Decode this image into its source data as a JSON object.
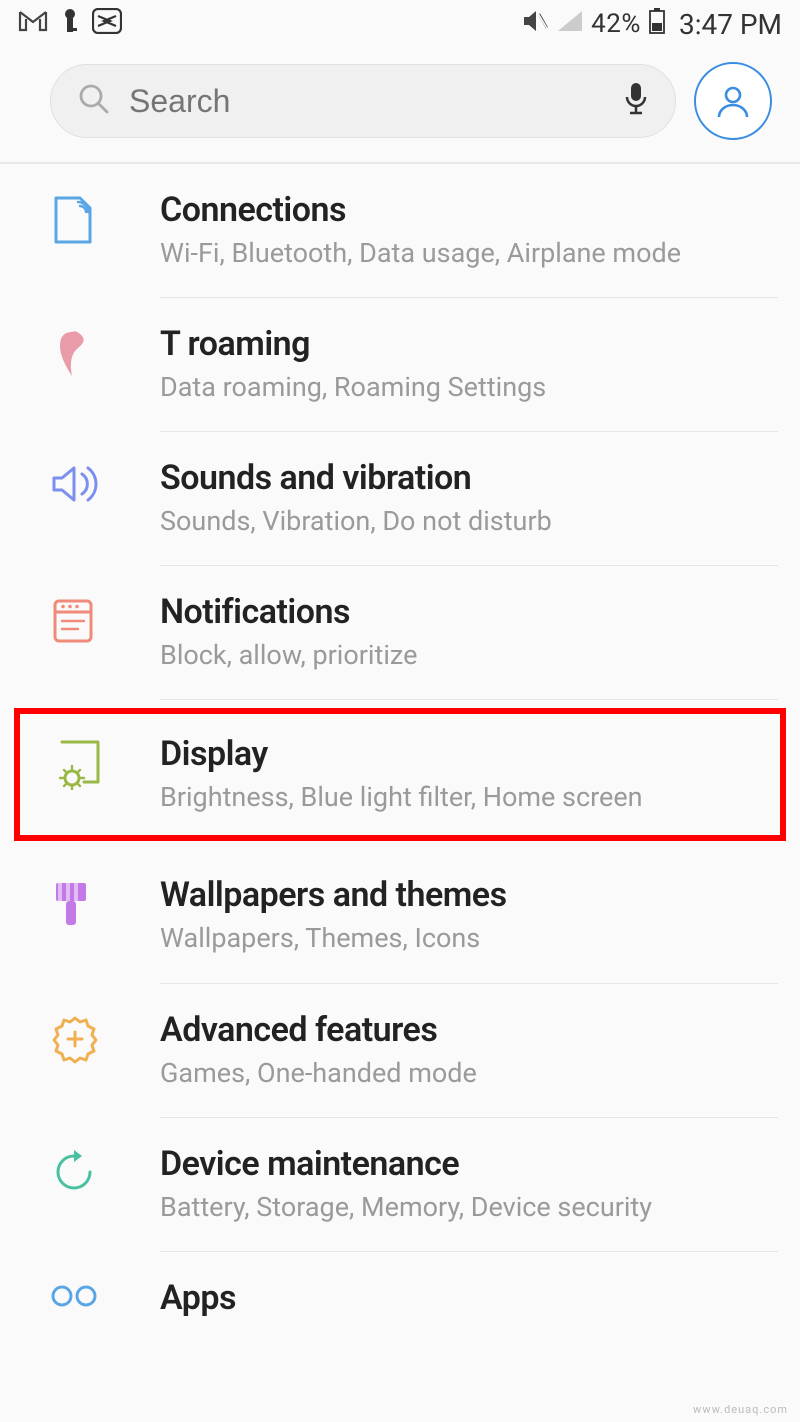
{
  "status": {
    "battery_pct": "42%",
    "time": "3:47 PM"
  },
  "search": {
    "placeholder": "Search"
  },
  "settings": [
    {
      "id": "connections",
      "title": "Connections",
      "sub": "Wi-Fi, Bluetooth, Data usage, Airplane mode",
      "icon": "sim",
      "color": "#5aa5e6"
    },
    {
      "id": "troaming",
      "title": "T roaming",
      "sub": "Data roaming, Roaming Settings",
      "icon": "roaming",
      "color": "#e68a9a"
    },
    {
      "id": "sounds",
      "title": "Sounds and vibration",
      "sub": "Sounds, Vibration, Do not disturb",
      "icon": "sound",
      "color": "#7a8ff0"
    },
    {
      "id": "notifications",
      "title": "Notifications",
      "sub": "Block, allow, prioritize",
      "icon": "notif",
      "color": "#f08a7a"
    },
    {
      "id": "display",
      "title": "Display",
      "sub": "Brightness, Blue light filter, Home screen",
      "icon": "display",
      "color": "#9ab845",
      "highlighted": true
    },
    {
      "id": "wallpapers",
      "title": "Wallpapers and themes",
      "sub": "Wallpapers, Themes, Icons",
      "icon": "brush",
      "color": "#c47ae6"
    },
    {
      "id": "advanced",
      "title": "Advanced features",
      "sub": "Games, One-handed mode",
      "icon": "gear-plus",
      "color": "#f0b050"
    },
    {
      "id": "maintenance",
      "title": "Device maintenance",
      "sub": "Battery, Storage, Memory, Device security",
      "icon": "refresh",
      "color": "#4ac0a0"
    },
    {
      "id": "apps",
      "title": "Apps",
      "sub": "",
      "icon": "apps",
      "color": "#5aa5e6"
    }
  ],
  "watermark": "www.deuaq.com"
}
